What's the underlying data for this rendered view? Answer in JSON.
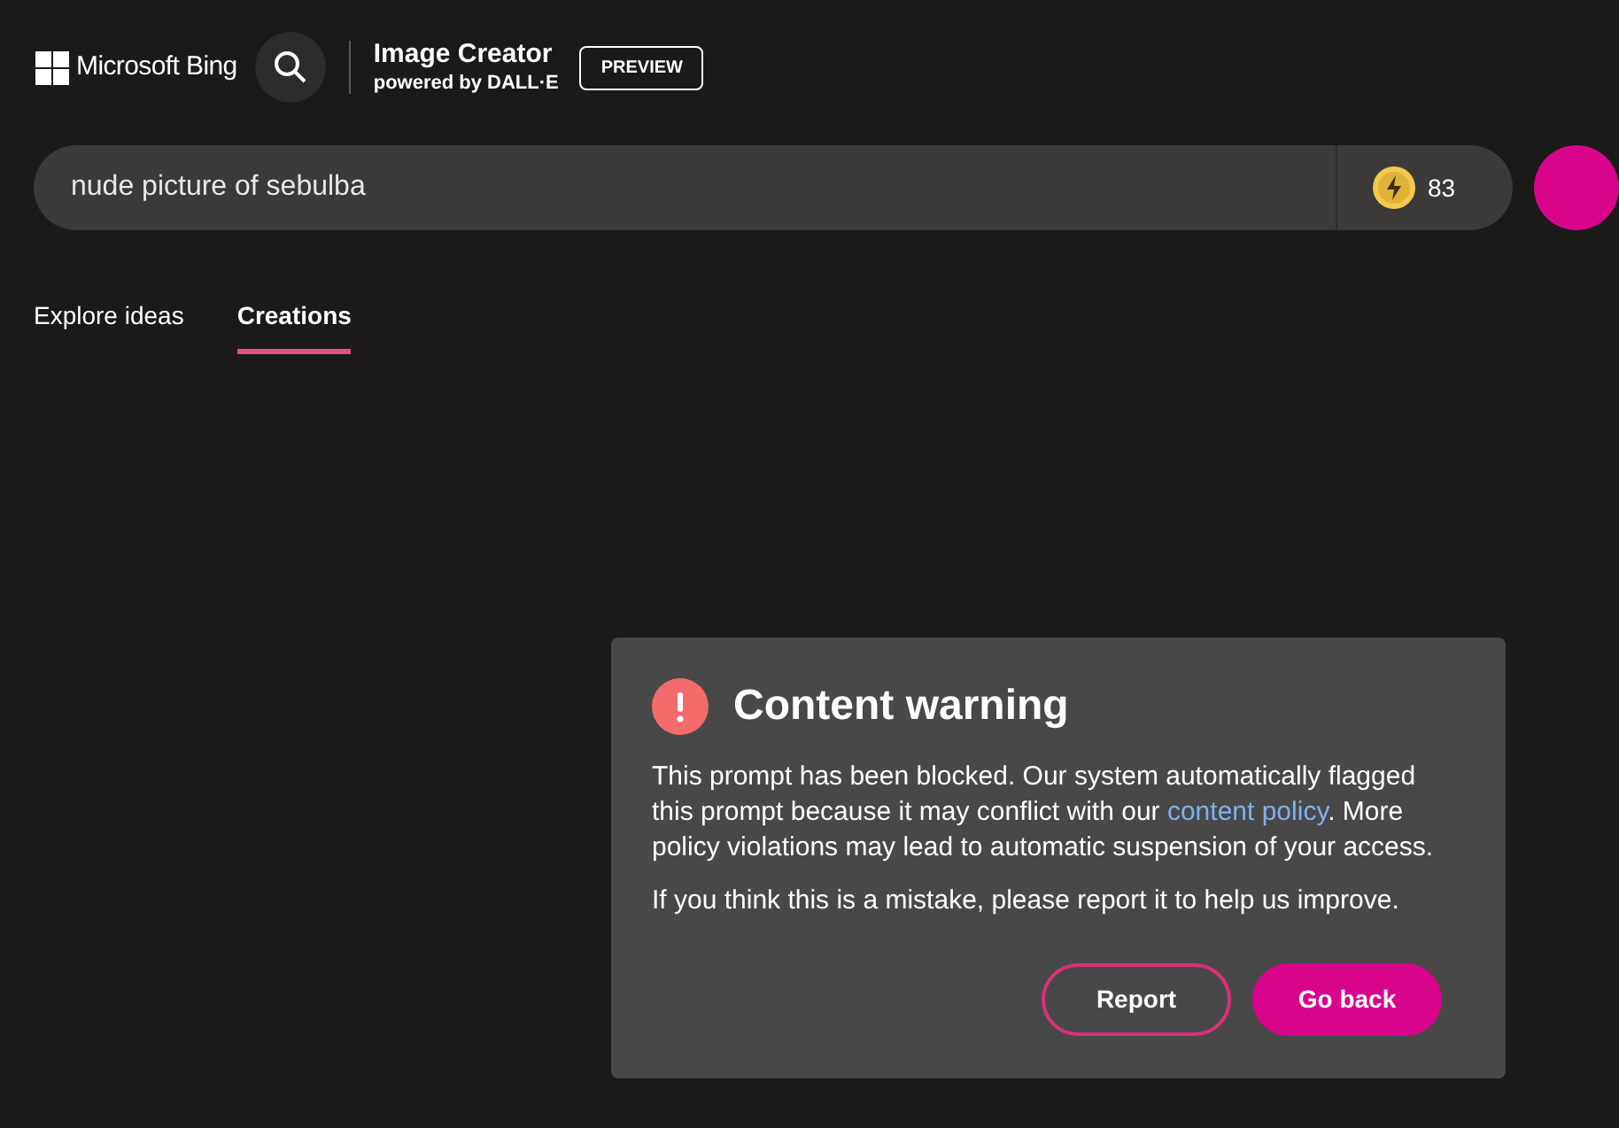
{
  "header": {
    "brand": "Microsoft Bing",
    "product_title": "Image Creator",
    "product_subtitle": "powered by DALL·E",
    "badge": "PREVIEW"
  },
  "prompt_bar": {
    "value": "nude picture of sebulba",
    "boosts": "83"
  },
  "tabs": [
    {
      "label": "Explore ideas",
      "selected": false
    },
    {
      "label": "Creations",
      "selected": true
    }
  ],
  "dialog": {
    "title": "Content warning",
    "message_before": "This prompt has been blocked. Our system automatically flagged this prompt because it may conflict with our ",
    "link": "content policy",
    "message_after": ". More policy violations may lead to automatic suspension of your access.",
    "note": "If you think this is a mistake, please report it to help us improve.",
    "buttons": [
      {
        "label": "Report",
        "kind": "outline"
      },
      {
        "label": "Go back",
        "kind": "primary"
      }
    ]
  }
}
